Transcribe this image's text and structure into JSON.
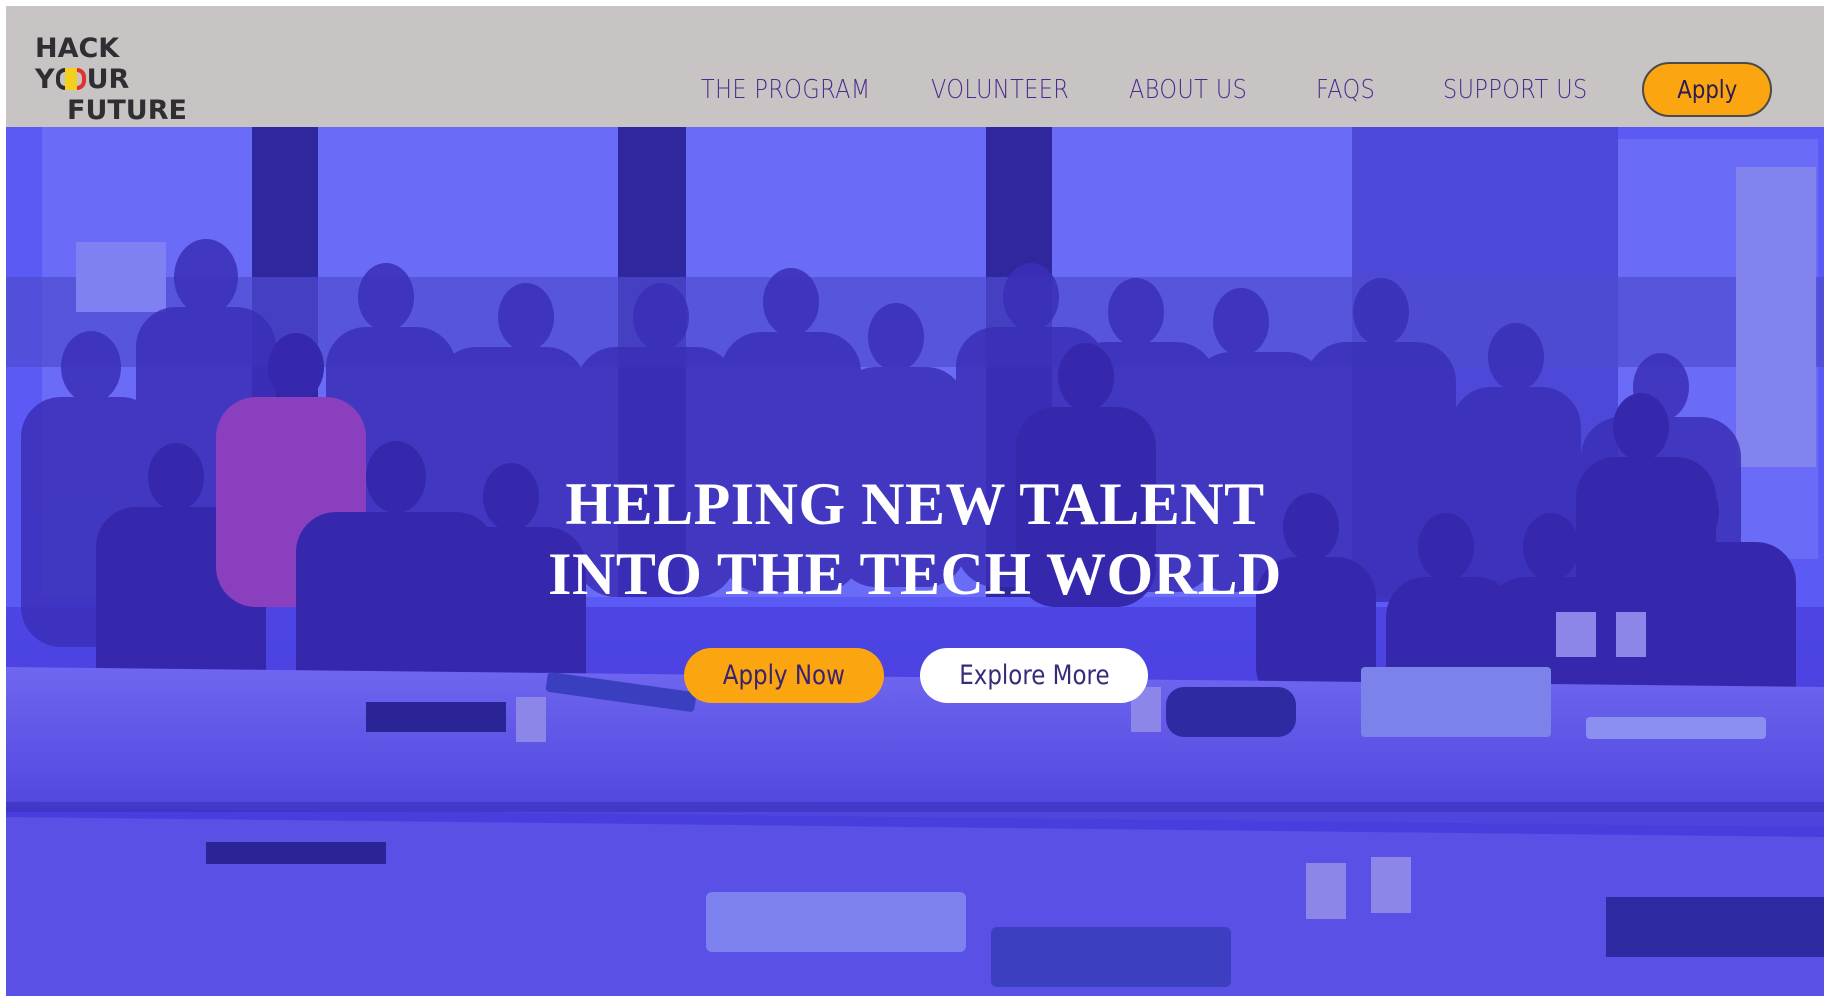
{
  "brand": {
    "logo_line1": "HACK",
    "logo_line2_left": "Y",
    "logo_line2_right": "UR",
    "logo_line3": "FUTURE"
  },
  "nav": {
    "items": [
      {
        "label": "THE PROGRAM"
      },
      {
        "label": "VOLUNTEER"
      },
      {
        "label": "ABOUT US"
      },
      {
        "label": "FAQS"
      },
      {
        "label": "SUPPORT US"
      }
    ],
    "apply_label": "Apply"
  },
  "hero": {
    "title_line1": "HELPING NEW TALENT",
    "title_line2": "INTO THE TECH WORLD",
    "apply_now_label": "Apply Now",
    "explore_label": "Explore More",
    "overlay_color": "#3f33e6"
  },
  "colors": {
    "header_bg": "#c9c4c4",
    "nav_text": "#4b2a8c",
    "accent_orange": "#fba510",
    "flag_yellow": "#f3cf1e",
    "flag_red": "#e0312f"
  }
}
